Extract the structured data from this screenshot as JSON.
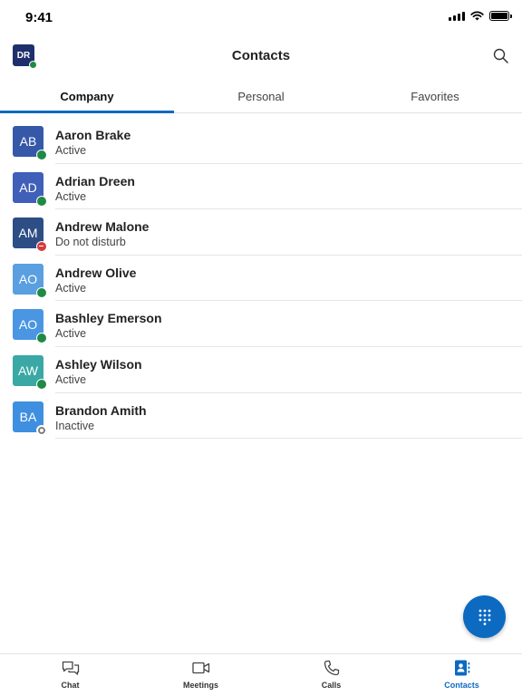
{
  "status_bar": {
    "time": "9:41"
  },
  "header": {
    "title": "Contacts",
    "profile_initials": "DR",
    "profile_presence": "active"
  },
  "tabs": [
    {
      "label": "Company",
      "active": true
    },
    {
      "label": "Personal",
      "active": false
    },
    {
      "label": "Favorites",
      "active": false
    }
  ],
  "contacts": [
    {
      "initials": "AB",
      "name": "Aaron Brake",
      "status": "Active",
      "presence": "active",
      "color": "#3558a8"
    },
    {
      "initials": "AD",
      "name": "Adrian Dreen",
      "status": "Active",
      "presence": "active",
      "color": "#3f5fb8"
    },
    {
      "initials": "AM",
      "name": "Andrew Malone",
      "status": "Do not disturb",
      "presence": "dnd",
      "color": "#2d4d85"
    },
    {
      "initials": "AO",
      "name": "Andrew Olive",
      "status": "Active",
      "presence": "active",
      "color": "#5a9fe0"
    },
    {
      "initials": "AO",
      "name": "Bashley Emerson",
      "status": "Active",
      "presence": "active",
      "color": "#4a96e3"
    },
    {
      "initials": "AW",
      "name": "Ashley Wilson",
      "status": "Active",
      "presence": "active",
      "color": "#3aa8a4"
    },
    {
      "initials": "BA",
      "name": "Brandon Amith",
      "status": "Inactive",
      "presence": "inactive",
      "color": "#3f8fe0"
    }
  ],
  "bottom_nav": [
    {
      "label": "Chat",
      "icon": "chat-icon",
      "active": false
    },
    {
      "label": "Meetings",
      "icon": "video-icon",
      "active": false
    },
    {
      "label": "Calls",
      "icon": "phone-icon",
      "active": false
    },
    {
      "label": "Contacts",
      "icon": "contacts-icon",
      "active": true
    }
  ],
  "colors": {
    "accent": "#0c6ac1",
    "presence_active": "#1f8a45",
    "presence_dnd": "#d43b3b",
    "profile_avatar": "#1e2f6c"
  }
}
